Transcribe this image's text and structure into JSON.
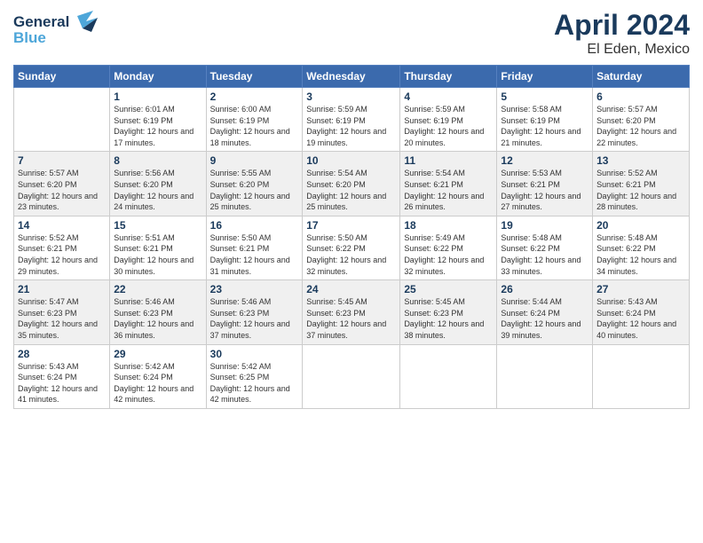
{
  "header": {
    "logo_line1": "General",
    "logo_line2": "Blue",
    "month": "April 2024",
    "location": "El Eden, Mexico"
  },
  "weekdays": [
    "Sunday",
    "Monday",
    "Tuesday",
    "Wednesday",
    "Thursday",
    "Friday",
    "Saturday"
  ],
  "weeks": [
    [
      {
        "day": "",
        "sunrise": "",
        "sunset": "",
        "daylight": ""
      },
      {
        "day": "1",
        "sunrise": "Sunrise: 6:01 AM",
        "sunset": "Sunset: 6:19 PM",
        "daylight": "Daylight: 12 hours and 17 minutes."
      },
      {
        "day": "2",
        "sunrise": "Sunrise: 6:00 AM",
        "sunset": "Sunset: 6:19 PM",
        "daylight": "Daylight: 12 hours and 18 minutes."
      },
      {
        "day": "3",
        "sunrise": "Sunrise: 5:59 AM",
        "sunset": "Sunset: 6:19 PM",
        "daylight": "Daylight: 12 hours and 19 minutes."
      },
      {
        "day": "4",
        "sunrise": "Sunrise: 5:59 AM",
        "sunset": "Sunset: 6:19 PM",
        "daylight": "Daylight: 12 hours and 20 minutes."
      },
      {
        "day": "5",
        "sunrise": "Sunrise: 5:58 AM",
        "sunset": "Sunset: 6:19 PM",
        "daylight": "Daylight: 12 hours and 21 minutes."
      },
      {
        "day": "6",
        "sunrise": "Sunrise: 5:57 AM",
        "sunset": "Sunset: 6:20 PM",
        "daylight": "Daylight: 12 hours and 22 minutes."
      }
    ],
    [
      {
        "day": "7",
        "sunrise": "Sunrise: 5:57 AM",
        "sunset": "Sunset: 6:20 PM",
        "daylight": "Daylight: 12 hours and 23 minutes."
      },
      {
        "day": "8",
        "sunrise": "Sunrise: 5:56 AM",
        "sunset": "Sunset: 6:20 PM",
        "daylight": "Daylight: 12 hours and 24 minutes."
      },
      {
        "day": "9",
        "sunrise": "Sunrise: 5:55 AM",
        "sunset": "Sunset: 6:20 PM",
        "daylight": "Daylight: 12 hours and 25 minutes."
      },
      {
        "day": "10",
        "sunrise": "Sunrise: 5:54 AM",
        "sunset": "Sunset: 6:20 PM",
        "daylight": "Daylight: 12 hours and 25 minutes."
      },
      {
        "day": "11",
        "sunrise": "Sunrise: 5:54 AM",
        "sunset": "Sunset: 6:21 PM",
        "daylight": "Daylight: 12 hours and 26 minutes."
      },
      {
        "day": "12",
        "sunrise": "Sunrise: 5:53 AM",
        "sunset": "Sunset: 6:21 PM",
        "daylight": "Daylight: 12 hours and 27 minutes."
      },
      {
        "day": "13",
        "sunrise": "Sunrise: 5:52 AM",
        "sunset": "Sunset: 6:21 PM",
        "daylight": "Daylight: 12 hours and 28 minutes."
      }
    ],
    [
      {
        "day": "14",
        "sunrise": "Sunrise: 5:52 AM",
        "sunset": "Sunset: 6:21 PM",
        "daylight": "Daylight: 12 hours and 29 minutes."
      },
      {
        "day": "15",
        "sunrise": "Sunrise: 5:51 AM",
        "sunset": "Sunset: 6:21 PM",
        "daylight": "Daylight: 12 hours and 30 minutes."
      },
      {
        "day": "16",
        "sunrise": "Sunrise: 5:50 AM",
        "sunset": "Sunset: 6:21 PM",
        "daylight": "Daylight: 12 hours and 31 minutes."
      },
      {
        "day": "17",
        "sunrise": "Sunrise: 5:50 AM",
        "sunset": "Sunset: 6:22 PM",
        "daylight": "Daylight: 12 hours and 32 minutes."
      },
      {
        "day": "18",
        "sunrise": "Sunrise: 5:49 AM",
        "sunset": "Sunset: 6:22 PM",
        "daylight": "Daylight: 12 hours and 32 minutes."
      },
      {
        "day": "19",
        "sunrise": "Sunrise: 5:48 AM",
        "sunset": "Sunset: 6:22 PM",
        "daylight": "Daylight: 12 hours and 33 minutes."
      },
      {
        "day": "20",
        "sunrise": "Sunrise: 5:48 AM",
        "sunset": "Sunset: 6:22 PM",
        "daylight": "Daylight: 12 hours and 34 minutes."
      }
    ],
    [
      {
        "day": "21",
        "sunrise": "Sunrise: 5:47 AM",
        "sunset": "Sunset: 6:23 PM",
        "daylight": "Daylight: 12 hours and 35 minutes."
      },
      {
        "day": "22",
        "sunrise": "Sunrise: 5:46 AM",
        "sunset": "Sunset: 6:23 PM",
        "daylight": "Daylight: 12 hours and 36 minutes."
      },
      {
        "day": "23",
        "sunrise": "Sunrise: 5:46 AM",
        "sunset": "Sunset: 6:23 PM",
        "daylight": "Daylight: 12 hours and 37 minutes."
      },
      {
        "day": "24",
        "sunrise": "Sunrise: 5:45 AM",
        "sunset": "Sunset: 6:23 PM",
        "daylight": "Daylight: 12 hours and 37 minutes."
      },
      {
        "day": "25",
        "sunrise": "Sunrise: 5:45 AM",
        "sunset": "Sunset: 6:23 PM",
        "daylight": "Daylight: 12 hours and 38 minutes."
      },
      {
        "day": "26",
        "sunrise": "Sunrise: 5:44 AM",
        "sunset": "Sunset: 6:24 PM",
        "daylight": "Daylight: 12 hours and 39 minutes."
      },
      {
        "day": "27",
        "sunrise": "Sunrise: 5:43 AM",
        "sunset": "Sunset: 6:24 PM",
        "daylight": "Daylight: 12 hours and 40 minutes."
      }
    ],
    [
      {
        "day": "28",
        "sunrise": "Sunrise: 5:43 AM",
        "sunset": "Sunset: 6:24 PM",
        "daylight": "Daylight: 12 hours and 41 minutes."
      },
      {
        "day": "29",
        "sunrise": "Sunrise: 5:42 AM",
        "sunset": "Sunset: 6:24 PM",
        "daylight": "Daylight: 12 hours and 42 minutes."
      },
      {
        "day": "30",
        "sunrise": "Sunrise: 5:42 AM",
        "sunset": "Sunset: 6:25 PM",
        "daylight": "Daylight: 12 hours and 42 minutes."
      },
      {
        "day": "",
        "sunrise": "",
        "sunset": "",
        "daylight": ""
      },
      {
        "day": "",
        "sunrise": "",
        "sunset": "",
        "daylight": ""
      },
      {
        "day": "",
        "sunrise": "",
        "sunset": "",
        "daylight": ""
      },
      {
        "day": "",
        "sunrise": "",
        "sunset": "",
        "daylight": ""
      }
    ]
  ]
}
